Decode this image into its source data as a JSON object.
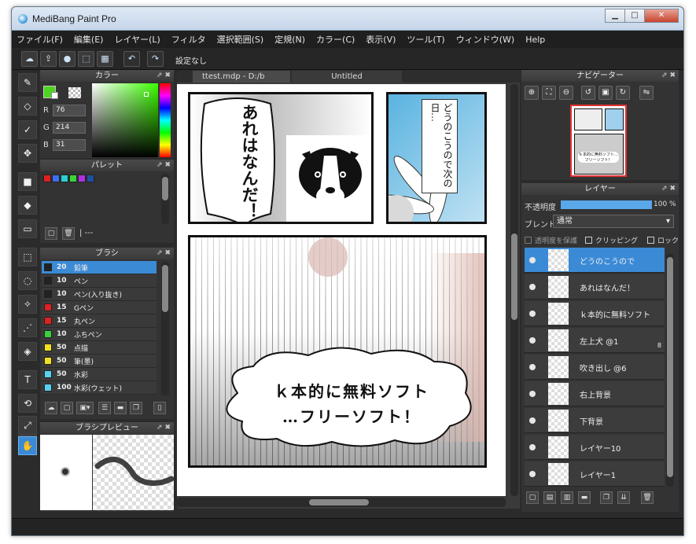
{
  "window": {
    "title": "MediBang Paint Pro"
  },
  "menu": [
    "ファイル(F)",
    "編集(E)",
    "レイヤー(L)",
    "フィルタ",
    "選択範囲(S)",
    "定規(N)",
    "カラー(C)",
    "表示(V)",
    "ツール(T)",
    "ウィンドウ(W)",
    "Help"
  ],
  "toolbar": {
    "setting_label": "設定なし"
  },
  "color_panel": {
    "title": "カラー",
    "r_label": "R",
    "g_label": "G",
    "b_label": "B",
    "r": "76",
    "g": "214",
    "b": "31",
    "primary": "#4cd61f",
    "secondary": "#ffffff"
  },
  "palette_panel": {
    "title": "パレット",
    "swatches": [
      "#e02020",
      "#3b6ef0",
      "#2ad0d0",
      "#3ad23a",
      "#b030e0",
      "#2050a0"
    ],
    "footer": "| ---"
  },
  "brush_panel": {
    "title": "ブラシ",
    "items": [
      {
        "size": "20",
        "name": "鉛筆",
        "color": "#222222"
      },
      {
        "size": "10",
        "name": "ペン",
        "color": "#222222"
      },
      {
        "size": "10",
        "name": "ペン(入り抜き)",
        "color": "#222222"
      },
      {
        "size": "15",
        "name": "Gペン",
        "color": "#e02020"
      },
      {
        "size": "15",
        "name": "丸ペン",
        "color": "#e02020"
      },
      {
        "size": "10",
        "name": "ふちペン",
        "color": "#3ad23a"
      },
      {
        "size": "50",
        "name": "点描",
        "color": "#f0e020"
      },
      {
        "size": "50",
        "name": "筆(墨)",
        "color": "#f0e020"
      },
      {
        "size": "50",
        "name": "水彩",
        "color": "#5ad0f0"
      },
      {
        "size": "100",
        "name": "水彩(ウェット)",
        "color": "#5ad0f0"
      }
    ]
  },
  "brush_preview": {
    "title": "ブラシプレビュー"
  },
  "tabs": [
    {
      "label": "ttest.mdp - D:/b"
    },
    {
      "label": "Untitled"
    }
  ],
  "manga": {
    "bubble1": "あれはなんだ！",
    "bubble2": "どうのこうので次の日…",
    "bubble3_line1": "ｋ本的に無料ソフト",
    "bubble3_line2": "…フリーソフト！"
  },
  "navigator": {
    "title": "ナビゲーター",
    "thumb_text": "ｋ本的に無料ソフト…フリーソフト！"
  },
  "layer_panel": {
    "title": "レイヤー",
    "opacity_label": "不透明度",
    "opacity_value": "100 %",
    "opacity": 1.0,
    "blend_label": "ブレンド",
    "blend_value": "通常",
    "protect_label": "透明度を保護",
    "clipping_label": "クリッピング",
    "lock_label": "ロック",
    "layers": [
      {
        "name": "どうのこうので",
        "selected": true
      },
      {
        "name": "あれはなんだ！"
      },
      {
        "name": "ｋ本的に無料ソフト"
      },
      {
        "name": "左上犬 @1",
        "badge": "8"
      },
      {
        "name": "吹き出し @6"
      },
      {
        "name": "右上背景"
      },
      {
        "name": "下背景"
      },
      {
        "name": "レイヤー10"
      },
      {
        "name": "レイヤー1"
      }
    ]
  }
}
